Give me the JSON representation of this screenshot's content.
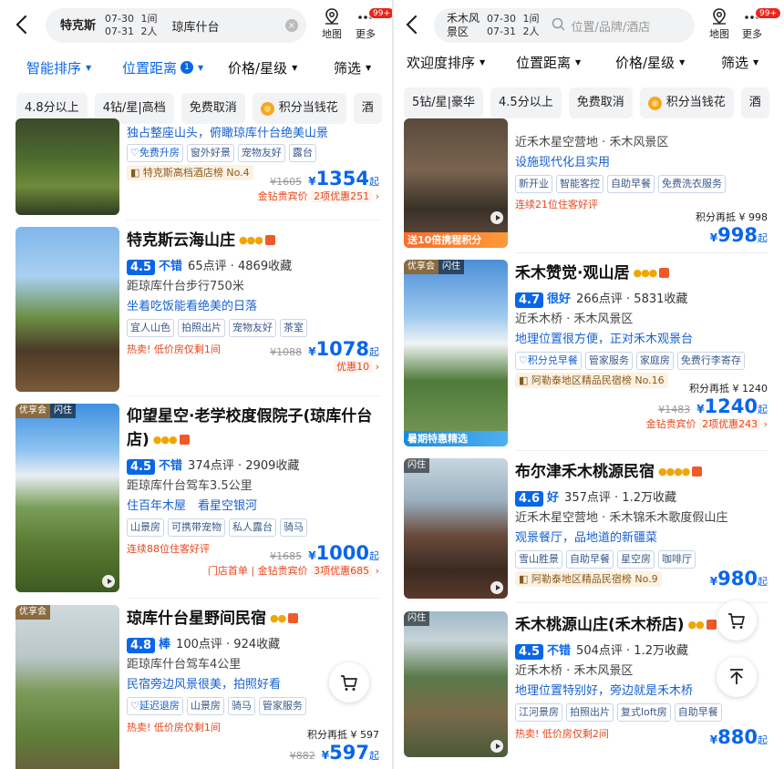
{
  "left": {
    "city": "特克斯",
    "checkin": "07-30",
    "checkout": "07-31",
    "rooms": "1间",
    "guests": "2人",
    "keyword": "琼库什台",
    "map_label": "地图",
    "more_label": "更多",
    "badge": "99+",
    "sorts": [
      "智能排序",
      "位置距离",
      "价格/星级",
      "筛选"
    ],
    "sort_count": "1",
    "chips": [
      "4.8分以上",
      "4钻/星|高档",
      "免费取消",
      "积分当钱花",
      "酒"
    ],
    "hotels": [
      {
        "highlight": "独占整座山头，俯瞰琼库什台绝美山景",
        "tags": [
          "免费升房",
          "窗外好景",
          "宠物友好",
          "露台"
        ],
        "rank": "特克斯高档酒店榜 No.4",
        "old_price": "¥1605",
        "price": "1354",
        "deal": "金钻贵宾价",
        "deal2": "2项优惠251"
      },
      {
        "name": "特克斯云海山庄",
        "score": "4.5",
        "rating_word": "不错",
        "reviews": "65点评",
        "favs": "4869收藏",
        "distance": "距琼库什台步行750米",
        "highlight": "坐着吃饭能看绝美的日落",
        "tags": [
          "宜人山色",
          "拍照出片",
          "宠物友好",
          "茶室"
        ],
        "hot": "热卖! 低价房仅剩1间",
        "old_price": "¥1088",
        "price": "1078",
        "deal": "优惠10"
      },
      {
        "name": "仰望星空·老学校度假院子(琼库什台店)",
        "photo_tags": [
          "优享会",
          "闪住"
        ],
        "score": "4.5",
        "rating_word": "不错",
        "reviews": "374点评",
        "favs": "2909收藏",
        "distance": "距琼库什台驾车3.5公里",
        "highlight": "住百年木屋　看星空银河",
        "tags": [
          "山景房",
          "可携带宠物",
          "私人露台",
          "骑马"
        ],
        "hot": "连续88位住客好评",
        "old_price": "¥1685",
        "price": "1000",
        "deal": "门店首单",
        "deal2": "金钻贵宾价",
        "deal3": "3项优惠685"
      },
      {
        "name": "琼库什台星野间民宿",
        "photo_tags": [
          "优享会"
        ],
        "score": "4.8",
        "rating_word": "棒",
        "reviews": "100点评",
        "favs": "924收藏",
        "distance": "距琼库什台驾车4公里",
        "highlight": "民宿旁边风景很美，拍照好看",
        "tags": [
          "延迟退房",
          "山景房",
          "骑马",
          "管家服务"
        ],
        "hot": "热卖! 低价房仅剩1间",
        "points": "积分再抵 ¥ 597",
        "old_price": "¥882",
        "price": "597"
      }
    ]
  },
  "right": {
    "city": "禾木风景区",
    "checkin": "07-30",
    "checkout": "07-31",
    "rooms": "1间",
    "guests": "2人",
    "placeholder": "位置/品牌/酒店",
    "map_label": "地图",
    "more_label": "更多",
    "badge": "99+",
    "sorts": [
      "欢迎度排序",
      "位置距离",
      "价格/星级",
      "筛选"
    ],
    "chips": [
      "5钻/星|豪华",
      "4.5分以上",
      "免费取消",
      "积分当钱花",
      "酒"
    ],
    "hotels": [
      {
        "distance": "近禾木星空营地 · 禾木风景区",
        "highlight": "设施现代化且实用",
        "tags": [
          "新开业",
          "智能客控",
          "自助早餐",
          "免费洗衣服务"
        ],
        "hot": "连续21位住客好评",
        "banner": "送10倍携程积分",
        "points": "积分再抵 ¥ 998",
        "price": "998"
      },
      {
        "name": "禾木赞觉·观山居",
        "photo_tags": [
          "优享会",
          "闪住"
        ],
        "banner": "暑期特惠精选",
        "score": "4.7",
        "rating_word": "很好",
        "reviews": "266点评",
        "favs": "5831收藏",
        "distance": "近禾木桥 · 禾木风景区",
        "highlight": "地理位置很方便，正对禾木观景台",
        "tags": [
          "积分兑早餐",
          "管家服务",
          "家庭房",
          "免费行李寄存"
        ],
        "rank": "阿勒泰地区精品民宿榜 No.16",
        "points": "积分再抵 ¥ 1240",
        "old_price": "¥1483",
        "price": "1240",
        "deal": "金钻贵宾价",
        "deal2": "2项优惠243"
      },
      {
        "name": "布尔津禾木桃源民宿",
        "photo_tags": [
          "闪住"
        ],
        "score": "4.6",
        "rating_word": "好",
        "reviews": "357点评",
        "favs": "1.2万收藏",
        "distance": "近禾木星空营地 · 禾木锦禾木歌度假山庄",
        "highlight": "观景餐厅，品地道的新疆菜",
        "tags": [
          "雪山胜景",
          "自助早餐",
          "星空房",
          "咖啡厅"
        ],
        "rank": "阿勒泰地区精品民宿榜 No.9",
        "price": "980"
      },
      {
        "name": "禾木桃源山庄(禾木桥店)",
        "photo_tags": [
          "闪住"
        ],
        "score": "4.5",
        "rating_word": "不错",
        "reviews": "504点评",
        "favs": "1.2万收藏",
        "distance": "近禾木桥 · 禾木风景区",
        "highlight": "地理位置特别好，旁边就是禾木桥",
        "tags": [
          "江河景房",
          "拍照出片",
          "复式loft房",
          "自助早餐"
        ],
        "hot": "热卖! 低价房仅剩2间",
        "price": "880"
      }
    ]
  },
  "common": {
    "qi": "起",
    "yen": "¥",
    "dot": "·",
    "arrow": "›",
    "clear_glyph": "×"
  }
}
